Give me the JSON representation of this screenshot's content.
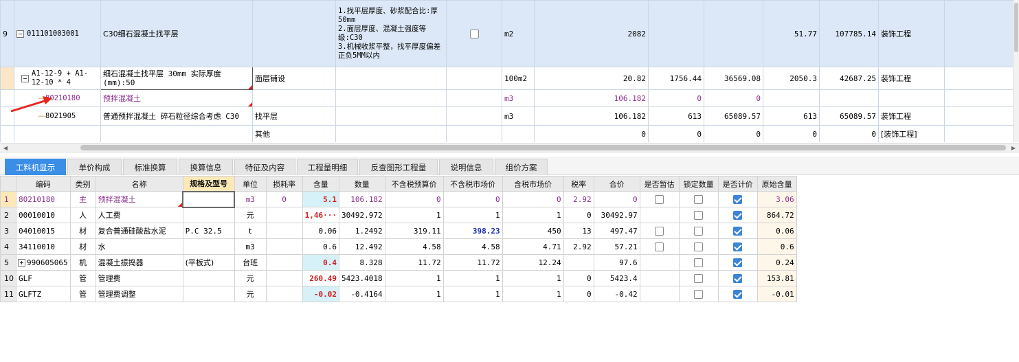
{
  "top_grid": {
    "rows": [
      {
        "rownum": "9",
        "code": "011101003001",
        "name": "C30细石混凝土找平层",
        "spec": "",
        "feature": "1.找平层厚度、砂浆配合比:厚50mm\n2.面层厚度、混凝土强度等级:C30\n3.机械收浆平整，找平厚度偏差正负5MM以内",
        "unit": "m2",
        "quantity": "2082",
        "unit_price": "",
        "total": "",
        "c10": "51.77",
        "c11": "107785.14",
        "category": "装饰工程"
      },
      {
        "code": "A1-12-9 + A1-12-10 * 4",
        "name": "细石混凝土找平层 30mm  实际厚度(mm):50",
        "spec": "面层铺设",
        "unit": "100m2",
        "quantity": "20.82",
        "unit_price": "1756.44",
        "total": "36569.08",
        "c10": "2050.3",
        "c11": "42687.25",
        "category": "装饰工程"
      },
      {
        "code": "80210180",
        "name": "预拌混凝土",
        "spec": "",
        "unit": "m3",
        "quantity": "106.182",
        "unit_price": "0",
        "total": "0",
        "c10": "",
        "c11": "",
        "category": ""
      },
      {
        "code": "8021905",
        "name": "普通预拌混凝土 碎石粒径综合考虑 C30",
        "spec": "找平层",
        "unit": "m3",
        "quantity": "106.182",
        "unit_price": "613",
        "total": "65089.57",
        "c10": "613",
        "c11": "65089.57",
        "category": "装饰工程"
      },
      {
        "code": "",
        "name": "",
        "spec": "其他",
        "unit": "",
        "quantity": "0",
        "unit_price": "0",
        "total": "0",
        "c10": "0",
        "c11": "0",
        "category": "[装饰工程]"
      }
    ]
  },
  "tabs": [
    "工料机显示",
    "单价构成",
    "标准换算",
    "换算信息",
    "特征及内容",
    "工程量明细",
    "反查图形工程量",
    "说明信息",
    "组价方案"
  ],
  "bottom_grid": {
    "headers": [
      "编码",
      "类别",
      "名称",
      "规格及型号",
      "单位",
      "损耗率",
      "含量",
      "数量",
      "不含税预算价",
      "不含税市场价",
      "含税市场价",
      "税率",
      "合价",
      "是否暂估",
      "锁定数量",
      "是否计价",
      "原始含量"
    ],
    "rows": [
      {
        "rn": "1",
        "code": "80210180",
        "type": "主",
        "name": "预拌混凝土",
        "spec": "",
        "unit": "m3",
        "loss": "0",
        "content": "5.1",
        "qty": "106.182",
        "p1": "0",
        "p2": "0",
        "p3": "0",
        "tax": "2.92",
        "sum": "0",
        "orig": "3.06"
      },
      {
        "rn": "2",
        "code": "00010010",
        "type": "人",
        "name": "人工费",
        "spec": "",
        "unit": "元",
        "loss": "",
        "content": "1,46···",
        "qty": "30492.972",
        "p1": "1",
        "p2": "1",
        "p3": "1",
        "tax": "0",
        "sum": "30492.97",
        "orig": "864.72"
      },
      {
        "rn": "3",
        "code": "04010015",
        "type": "材",
        "name": "复合普通硅酸盐水泥",
        "spec": "P.C 32.5",
        "unit": "t",
        "loss": "",
        "content": "0.06",
        "qty": "1.2492",
        "p1": "319.11",
        "p2": "398.23",
        "p3": "450",
        "tax": "13",
        "sum": "497.47",
        "orig": "0.06"
      },
      {
        "rn": "4",
        "code": "34110010",
        "type": "材",
        "name": "水",
        "spec": "",
        "unit": "m3",
        "loss": "",
        "content": "0.6",
        "qty": "12.492",
        "p1": "4.58",
        "p2": "4.58",
        "p3": "4.71",
        "tax": "2.92",
        "sum": "57.21",
        "orig": "0.6"
      },
      {
        "rn": "5",
        "code": "990605065",
        "type": "机",
        "name": "混凝土振捣器",
        "spec": "(平板式)",
        "unit": "台班",
        "loss": "",
        "content": "0.4",
        "qty": "8.328",
        "p1": "11.72",
        "p2": "11.72",
        "p3": "12.24",
        "tax": "",
        "sum": "97.6",
        "orig": "0.24"
      },
      {
        "rn": "10",
        "code": "GLF",
        "type": "管",
        "name": "管理费",
        "spec": "",
        "unit": "元",
        "loss": "",
        "content": "260.49",
        "qty": "5423.4018",
        "p1": "1",
        "p2": "1",
        "p3": "1",
        "tax": "0",
        "sum": "5423.4",
        "orig": "153.81"
      },
      {
        "rn": "11",
        "code": "GLFTZ",
        "type": "管",
        "name": "管理费调整",
        "spec": "",
        "unit": "元",
        "loss": "",
        "content": "-0.02",
        "qty": "-0.4164",
        "p1": "1",
        "p2": "1",
        "p3": "1",
        "tax": "0",
        "sum": "-0.42",
        "orig": "-0.01"
      }
    ]
  },
  "colors": {
    "accent": "#3a8ee6",
    "selected_row": "#dce8f7",
    "material_text": "#8a2d8a",
    "content_red": "#d41c1c",
    "content_bg": "#d6f1f8",
    "header_highlight": "#fde9b8"
  }
}
